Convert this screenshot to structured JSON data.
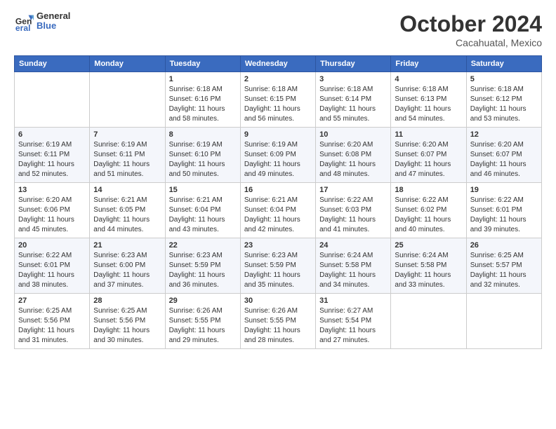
{
  "logo": {
    "general": "General",
    "blue": "Blue"
  },
  "header": {
    "month": "October 2024",
    "location": "Cacahuatal, Mexico"
  },
  "weekdays": [
    "Sunday",
    "Monday",
    "Tuesday",
    "Wednesday",
    "Thursday",
    "Friday",
    "Saturday"
  ],
  "weeks": [
    [
      {
        "day": "",
        "info": ""
      },
      {
        "day": "",
        "info": ""
      },
      {
        "day": "1",
        "info": "Sunrise: 6:18 AM\nSunset: 6:16 PM\nDaylight: 11 hours and 58 minutes."
      },
      {
        "day": "2",
        "info": "Sunrise: 6:18 AM\nSunset: 6:15 PM\nDaylight: 11 hours and 56 minutes."
      },
      {
        "day": "3",
        "info": "Sunrise: 6:18 AM\nSunset: 6:14 PM\nDaylight: 11 hours and 55 minutes."
      },
      {
        "day": "4",
        "info": "Sunrise: 6:18 AM\nSunset: 6:13 PM\nDaylight: 11 hours and 54 minutes."
      },
      {
        "day": "5",
        "info": "Sunrise: 6:18 AM\nSunset: 6:12 PM\nDaylight: 11 hours and 53 minutes."
      }
    ],
    [
      {
        "day": "6",
        "info": "Sunrise: 6:19 AM\nSunset: 6:11 PM\nDaylight: 11 hours and 52 minutes."
      },
      {
        "day": "7",
        "info": "Sunrise: 6:19 AM\nSunset: 6:11 PM\nDaylight: 11 hours and 51 minutes."
      },
      {
        "day": "8",
        "info": "Sunrise: 6:19 AM\nSunset: 6:10 PM\nDaylight: 11 hours and 50 minutes."
      },
      {
        "day": "9",
        "info": "Sunrise: 6:19 AM\nSunset: 6:09 PM\nDaylight: 11 hours and 49 minutes."
      },
      {
        "day": "10",
        "info": "Sunrise: 6:20 AM\nSunset: 6:08 PM\nDaylight: 11 hours and 48 minutes."
      },
      {
        "day": "11",
        "info": "Sunrise: 6:20 AM\nSunset: 6:07 PM\nDaylight: 11 hours and 47 minutes."
      },
      {
        "day": "12",
        "info": "Sunrise: 6:20 AM\nSunset: 6:07 PM\nDaylight: 11 hours and 46 minutes."
      }
    ],
    [
      {
        "day": "13",
        "info": "Sunrise: 6:20 AM\nSunset: 6:06 PM\nDaylight: 11 hours and 45 minutes."
      },
      {
        "day": "14",
        "info": "Sunrise: 6:21 AM\nSunset: 6:05 PM\nDaylight: 11 hours and 44 minutes."
      },
      {
        "day": "15",
        "info": "Sunrise: 6:21 AM\nSunset: 6:04 PM\nDaylight: 11 hours and 43 minutes."
      },
      {
        "day": "16",
        "info": "Sunrise: 6:21 AM\nSunset: 6:04 PM\nDaylight: 11 hours and 42 minutes."
      },
      {
        "day": "17",
        "info": "Sunrise: 6:22 AM\nSunset: 6:03 PM\nDaylight: 11 hours and 41 minutes."
      },
      {
        "day": "18",
        "info": "Sunrise: 6:22 AM\nSunset: 6:02 PM\nDaylight: 11 hours and 40 minutes."
      },
      {
        "day": "19",
        "info": "Sunrise: 6:22 AM\nSunset: 6:01 PM\nDaylight: 11 hours and 39 minutes."
      }
    ],
    [
      {
        "day": "20",
        "info": "Sunrise: 6:22 AM\nSunset: 6:01 PM\nDaylight: 11 hours and 38 minutes."
      },
      {
        "day": "21",
        "info": "Sunrise: 6:23 AM\nSunset: 6:00 PM\nDaylight: 11 hours and 37 minutes."
      },
      {
        "day": "22",
        "info": "Sunrise: 6:23 AM\nSunset: 5:59 PM\nDaylight: 11 hours and 36 minutes."
      },
      {
        "day": "23",
        "info": "Sunrise: 6:23 AM\nSunset: 5:59 PM\nDaylight: 11 hours and 35 minutes."
      },
      {
        "day": "24",
        "info": "Sunrise: 6:24 AM\nSunset: 5:58 PM\nDaylight: 11 hours and 34 minutes."
      },
      {
        "day": "25",
        "info": "Sunrise: 6:24 AM\nSunset: 5:58 PM\nDaylight: 11 hours and 33 minutes."
      },
      {
        "day": "26",
        "info": "Sunrise: 6:25 AM\nSunset: 5:57 PM\nDaylight: 11 hours and 32 minutes."
      }
    ],
    [
      {
        "day": "27",
        "info": "Sunrise: 6:25 AM\nSunset: 5:56 PM\nDaylight: 11 hours and 31 minutes."
      },
      {
        "day": "28",
        "info": "Sunrise: 6:25 AM\nSunset: 5:56 PM\nDaylight: 11 hours and 30 minutes."
      },
      {
        "day": "29",
        "info": "Sunrise: 6:26 AM\nSunset: 5:55 PM\nDaylight: 11 hours and 29 minutes."
      },
      {
        "day": "30",
        "info": "Sunrise: 6:26 AM\nSunset: 5:55 PM\nDaylight: 11 hours and 28 minutes."
      },
      {
        "day": "31",
        "info": "Sunrise: 6:27 AM\nSunset: 5:54 PM\nDaylight: 11 hours and 27 minutes."
      },
      {
        "day": "",
        "info": ""
      },
      {
        "day": "",
        "info": ""
      }
    ]
  ]
}
